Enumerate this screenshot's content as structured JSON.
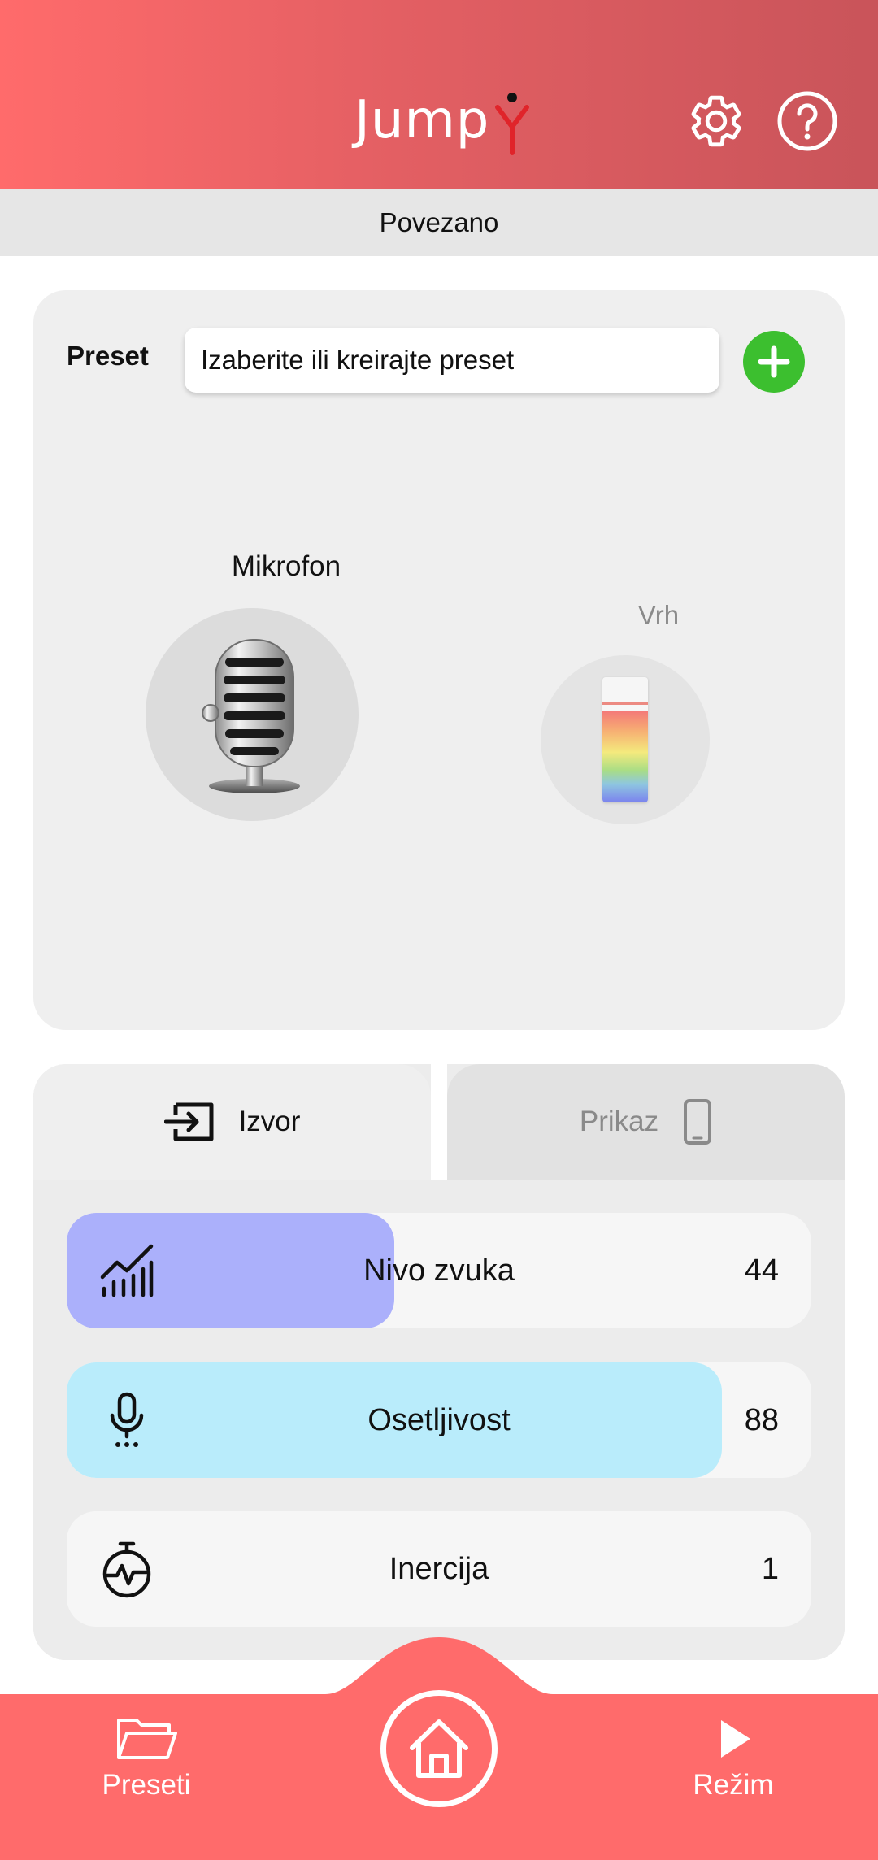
{
  "app": {
    "title_text": "Jump",
    "logo_mark_color": "#e0242a",
    "accent_color": "#ff6b6b"
  },
  "header": {
    "settings_icon": "gear-icon",
    "help_icon": "question-circle-icon"
  },
  "status": {
    "text": "Povezano"
  },
  "preset": {
    "label": "Preset",
    "placeholder": "Izaberite ili kreirajte preset",
    "add_icon": "plus-circle-icon",
    "add_color": "#3cbf2f"
  },
  "microphone": {
    "label": "Mikrofon",
    "icon": "microphone-image"
  },
  "peak": {
    "label": "Vrh",
    "level": 0.73,
    "peak_hold": 0.74
  },
  "tabs": [
    {
      "label": "Izvor",
      "icon": "input-arrow-icon",
      "active": true
    },
    {
      "label": "Prikaz",
      "icon": "phone-icon",
      "active": false
    }
  ],
  "sliders": [
    {
      "label": "Nivo zvuka",
      "value": "44",
      "level": 0.44,
      "icon": "chart-bars-icon",
      "color": "#abb0fb"
    },
    {
      "label": "Osetljivost",
      "value": "88",
      "level": 0.88,
      "icon": "microphone-icon",
      "color": "#b9ecfb"
    },
    {
      "label": "Inercija",
      "value": "1",
      "level": 0.0,
      "icon": "stopwatch-icon",
      "color": "#f6f6f6"
    }
  ],
  "bottom_nav": {
    "presets_label": "Preseti",
    "presets_icon": "folder-icon",
    "home_icon": "home-icon",
    "mode_label": "Režim",
    "mode_icon": "play-icon"
  }
}
